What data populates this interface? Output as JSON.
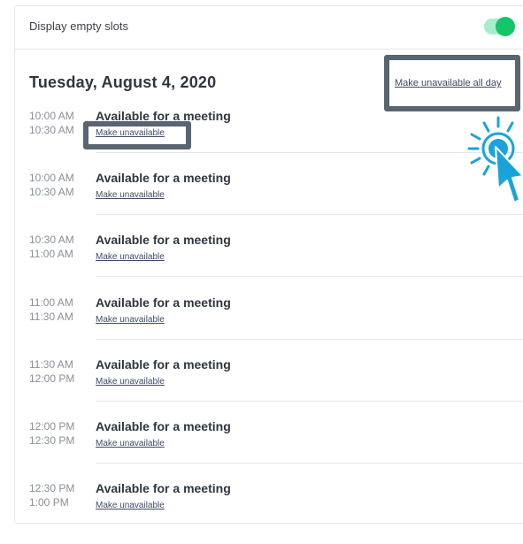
{
  "settings": {
    "display_empty_slots_label": "Display empty slots",
    "display_empty_slots_on": true
  },
  "schedule": {
    "date_title": "Tuesday, August 4, 2020",
    "make_unavailable_all_day": "Make unavailable all day",
    "slots": [
      {
        "start": "10:00 AM",
        "end": "10:30 AM",
        "title": "Available for a meeting",
        "action": "Make unavailable"
      },
      {
        "start": "10:00 AM",
        "end": "10:30 AM",
        "title": "Available for a meeting",
        "action": "Make unavailable"
      },
      {
        "start": "10:30 AM",
        "end": "11:00 AM",
        "title": "Available for a meeting",
        "action": "Make unavailable"
      },
      {
        "start": "11:00 AM",
        "end": "11:30 AM",
        "title": "Available for a meeting",
        "action": "Make unavailable"
      },
      {
        "start": "11:30 AM",
        "end": "12:00 PM",
        "title": "Available for a meeting",
        "action": "Make unavailable"
      },
      {
        "start": "12:00 PM",
        "end": "12:30 PM",
        "title": "Available for a meeting",
        "action": "Make unavailable"
      },
      {
        "start": "12:30 PM",
        "end": "1:00 PM",
        "title": "Available for a meeting",
        "action": "Make unavailable"
      }
    ]
  },
  "colors": {
    "toggle_on": "#14c56a",
    "highlight_border": "#59656f",
    "cursor": "#1aa3d9",
    "link": "#3f4b66"
  },
  "icons": {
    "cursor": "click-cursor-icon"
  }
}
